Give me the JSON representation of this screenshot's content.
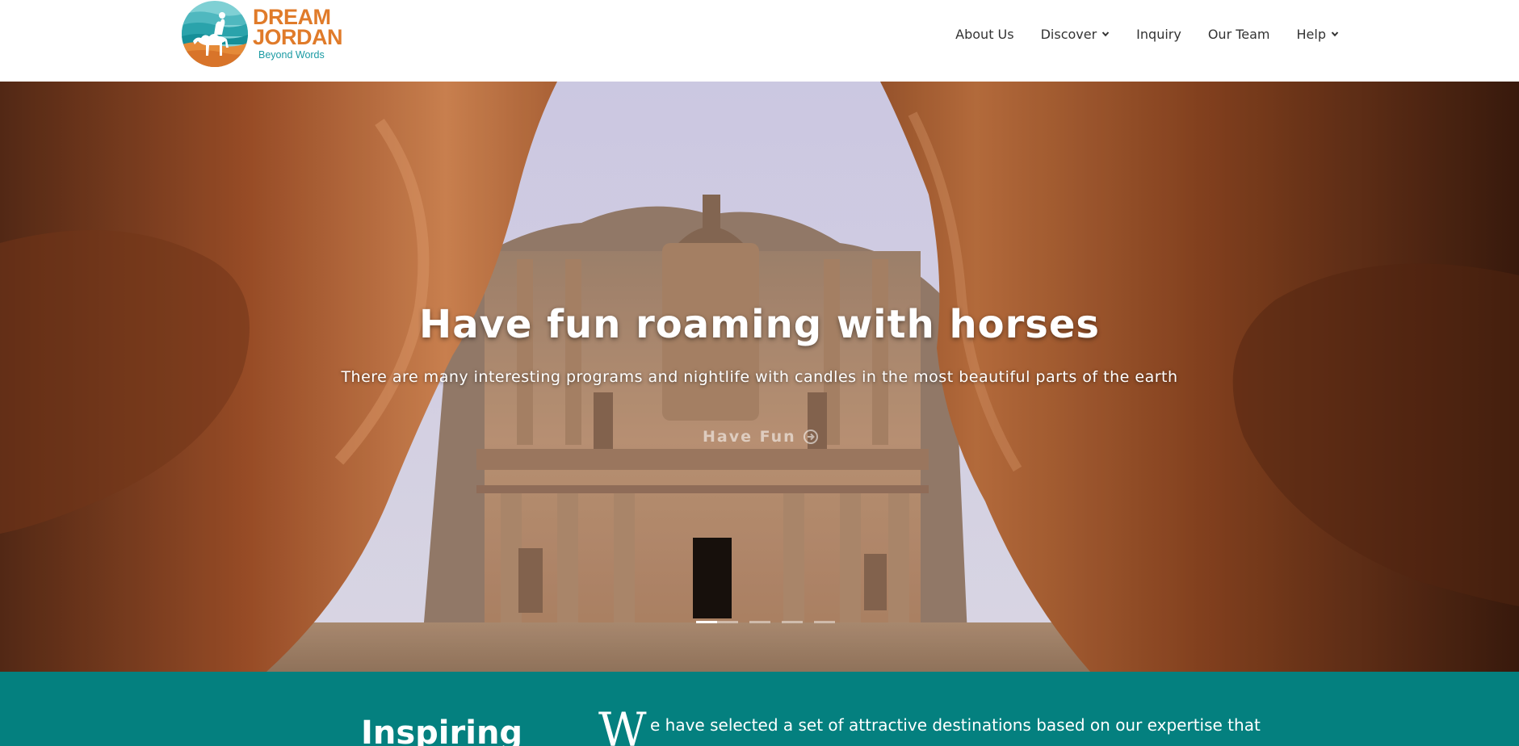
{
  "header": {
    "logo": {
      "line1": "DREAM",
      "line2": "JORDAN",
      "tagline": "Beyond Words",
      "icon": "camel-rider-icon"
    },
    "nav": [
      {
        "label": "About Us",
        "dropdown": false
      },
      {
        "label": "Discover",
        "dropdown": true
      },
      {
        "label": "Inquiry",
        "dropdown": false
      },
      {
        "label": "Our Team",
        "dropdown": false
      },
      {
        "label": "Help",
        "dropdown": true
      }
    ]
  },
  "hero": {
    "title": "Have fun roaming with horses",
    "subtitle": "There are many interesting programs and nightlife with candles in the most beautiful parts of the earth",
    "button_label": "Have Fun",
    "button_icon": "arrow-circle-right-icon",
    "slides_total": 4,
    "active_slide": 1
  },
  "intro": {
    "heading": "Inspiring",
    "dropcap": "W",
    "text": "e have selected a set of attractive destinations based on our expertise that"
  },
  "colors": {
    "brand_orange": "#e07b2a",
    "brand_teal": "#1a9aa3",
    "section_teal": "#04807f"
  }
}
